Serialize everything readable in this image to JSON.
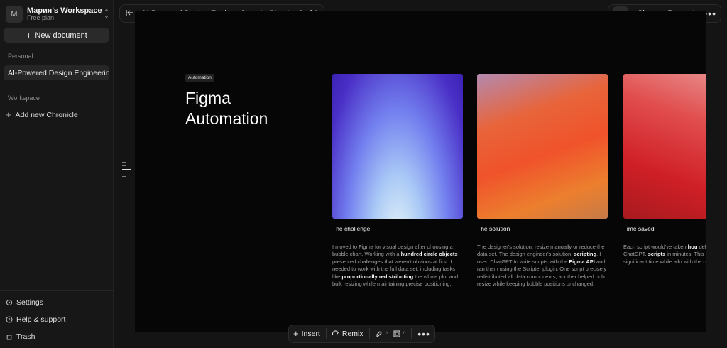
{
  "sidebar": {
    "workspace": {
      "avatar": "M",
      "name": "Мария's Workspace",
      "plan": "Free plan"
    },
    "new_document": "New document",
    "personal_label": "Personal",
    "documents": [
      "AI-Powered Design Engineering"
    ],
    "workspace_label": "Workspace",
    "add_chronicle": "Add new Chronicle",
    "bottom": {
      "settings": "Settings",
      "help": "Help & support",
      "trash": "Trash"
    }
  },
  "topbar": {
    "doc_title": "AI-Powered Design Engineering",
    "separator": "/",
    "chapter": "Chapter 3 of 6",
    "user_initial": "A",
    "share": "Share",
    "present": "Present",
    "more": "•••"
  },
  "slide": {
    "tag": "Automation",
    "title_line1": "Figma",
    "title_line2": "Automation",
    "cards": [
      {
        "heading": "The challenge",
        "p1": "I moved to Figma for visual design after choosing a bubble chart. Working with a ",
        "b1": "hundred circle objects",
        "p2": " presented challenges that weren't obvious at first. I needed to work with the full data set, including tasks like ",
        "b2": "proportionally redistributing",
        "p3": " the whole plot and bulk resizing while maintaining precise positioning."
      },
      {
        "heading": "The solution",
        "p1": "The designer's solution: resize manually or reduce the data set. The design engineer's solution: ",
        "b1": "scripting",
        "p2": ". I used ChatGPT to write scripts with the ",
        "b2": "Figma API",
        "p3": " and ran them using the Scripter plugin. One script precisely redistributed all data components, another helped bulk resize while keeping bubble positions unchanged."
      },
      {
        "heading": "Time saved",
        "p1": "Each script would've taken ",
        "b1": "hou",
        "p2": " debug manually. With ChatGPT, ",
        "b2": "scripts",
        "p3": " in minutes. This automat saved significant time while allo with the complete data set."
      }
    ]
  },
  "toolbar": {
    "insert": "Insert",
    "remix": "Remix",
    "more": "•••"
  },
  "colors": {
    "background": "#141414",
    "canvas": "#060606",
    "sidebar": "#171717"
  }
}
